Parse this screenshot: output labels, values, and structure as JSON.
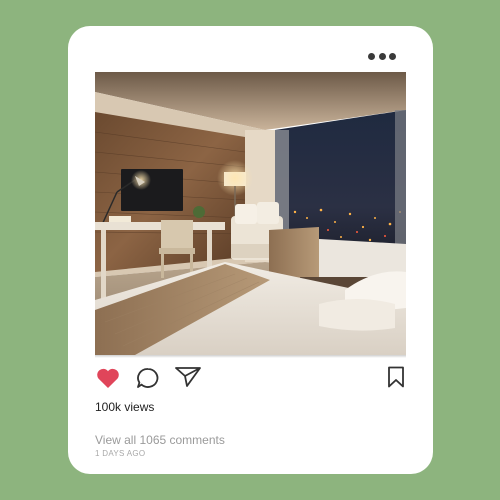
{
  "colors": {
    "background": "#8db47e",
    "card": "#ffffff",
    "like": "#e0455a",
    "icon_stroke": "#333333"
  },
  "icons": {
    "more": "more-horizontal-icon",
    "like": "heart-filled-icon",
    "comment": "comment-bubble-icon",
    "share": "paper-plane-icon",
    "save": "bookmark-icon"
  },
  "post": {
    "image_alt": "",
    "views_text": "100k views",
    "comments_link": "View all 1065 comments",
    "time_ago": "1 DAYS AGO"
  }
}
